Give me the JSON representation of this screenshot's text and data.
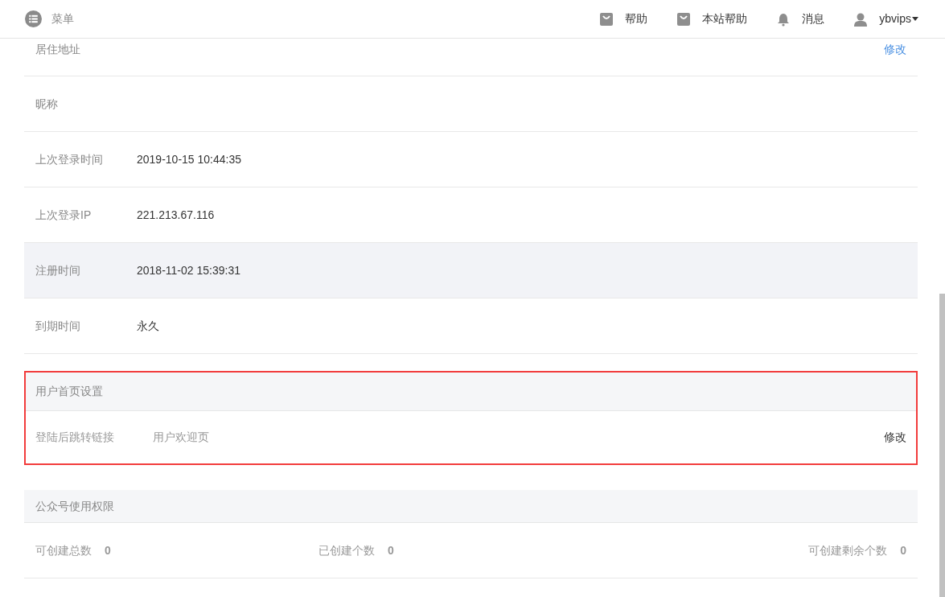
{
  "header": {
    "menu_label": "菜单",
    "nav": [
      {
        "kind": "bag",
        "label": "帮助"
      },
      {
        "kind": "bag",
        "label": "本站帮助"
      },
      {
        "kind": "bell",
        "label": "消息"
      },
      {
        "kind": "user",
        "label": "ybvips"
      }
    ]
  },
  "info_rows": [
    {
      "label": "居住地址",
      "action": "修改",
      "highlighted": false
    },
    {
      "label": "昵称",
      "highlighted": false
    },
    {
      "label": "上次登录时间",
      "value": "2019-10-15 10:44:35",
      "highlighted": false
    },
    {
      "label": "上次登录IP",
      "value": "221.213.67.116",
      "highlighted": false
    },
    {
      "label": "注册时间",
      "value": "2018-11-02 15:39:31",
      "highlighted": true
    },
    {
      "label": "到期时间",
      "value": "永久",
      "highlighted": false
    }
  ],
  "homepage_settings": {
    "title": "用户首页设置",
    "outlined": true,
    "label": "登陆后跳转链接",
    "value": "用户欢迎页",
    "action": "修改"
  },
  "account_permissions": {
    "title": "公众号使用权限",
    "stats": [
      {
        "label": "可创建总数",
        "value": "0"
      },
      {
        "label": "已创建个数",
        "value": "0"
      },
      {
        "label": "可创建剩余个数",
        "value": "0"
      }
    ]
  }
}
